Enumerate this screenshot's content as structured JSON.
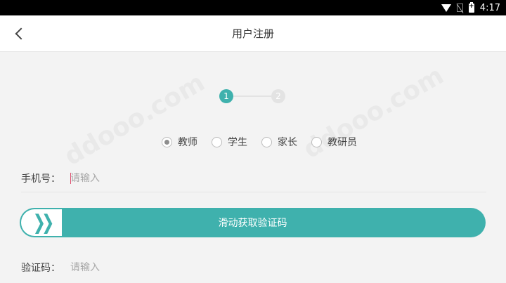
{
  "status_bar": {
    "time": "4:17"
  },
  "header": {
    "title": "用户注册"
  },
  "stepper": {
    "step1": "1",
    "step2": "2",
    "current": 1
  },
  "roles": [
    {
      "label": "教师",
      "selected": true
    },
    {
      "label": "学生",
      "selected": false
    },
    {
      "label": "家长",
      "selected": false
    },
    {
      "label": "教研员",
      "selected": false
    }
  ],
  "phone": {
    "label": "手机号：",
    "placeholder": "请输入"
  },
  "slider": {
    "text": "滑动获取验证码"
  },
  "code": {
    "label": "验证码：",
    "placeholder": "请输入"
  },
  "colors": {
    "accent": "#3fb1ad",
    "background": "#f3f3f3"
  },
  "icons": [
    "wifi-icon",
    "no-sim-icon",
    "battery-icon",
    "back-icon",
    "chevrons-icon"
  ]
}
